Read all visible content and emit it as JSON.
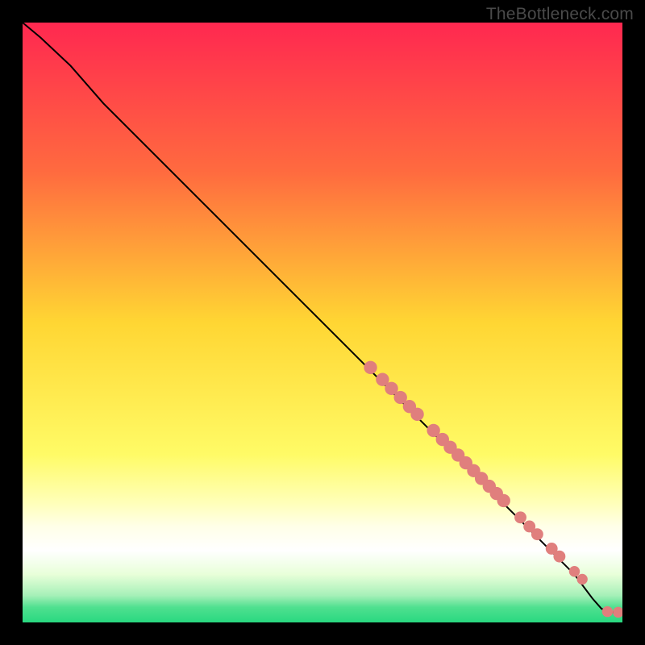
{
  "watermark": "TheBottleneck.com",
  "chart_data": {
    "type": "line",
    "title": "",
    "xlabel": "",
    "ylabel": "",
    "x_range": [
      0,
      100
    ],
    "y_range": [
      0,
      100
    ],
    "background_gradient_stops": [
      {
        "offset": 0.0,
        "color": "#ff2850"
      },
      {
        "offset": 0.25,
        "color": "#ff6b3f"
      },
      {
        "offset": 0.5,
        "color": "#ffd633"
      },
      {
        "offset": 0.72,
        "color": "#fffb66"
      },
      {
        "offset": 0.8,
        "color": "#ffffb8"
      },
      {
        "offset": 0.84,
        "color": "#ffffe8"
      },
      {
        "offset": 0.88,
        "color": "#ffffff"
      },
      {
        "offset": 0.92,
        "color": "#e8ffd9"
      },
      {
        "offset": 0.955,
        "color": "#a6f0b8"
      },
      {
        "offset": 0.975,
        "color": "#4fe08f"
      },
      {
        "offset": 1.0,
        "color": "#29d880"
      }
    ],
    "curve_points": [
      {
        "x": 0.0,
        "y": 100.0
      },
      {
        "x": 3.0,
        "y": 97.5
      },
      {
        "x": 8.0,
        "y": 92.8
      },
      {
        "x": 13.5,
        "y": 86.5
      },
      {
        "x": 55.0,
        "y": 45.0
      },
      {
        "x": 92.0,
        "y": 8.0
      },
      {
        "x": 95.0,
        "y": 4.0
      },
      {
        "x": 96.5,
        "y": 2.3
      },
      {
        "x": 97.8,
        "y": 1.7
      },
      {
        "x": 100.0,
        "y": 1.7
      }
    ],
    "markers": [
      {
        "x": 58.0,
        "y": 42.5,
        "r": 1.1
      },
      {
        "x": 60.0,
        "y": 40.5,
        "r": 1.1
      },
      {
        "x": 61.5,
        "y": 39.0,
        "r": 1.1
      },
      {
        "x": 63.0,
        "y": 37.5,
        "r": 1.1
      },
      {
        "x": 64.5,
        "y": 36.0,
        "r": 1.1
      },
      {
        "x": 65.8,
        "y": 34.7,
        "r": 1.1
      },
      {
        "x": 68.5,
        "y": 32.0,
        "r": 1.1
      },
      {
        "x": 70.0,
        "y": 30.5,
        "r": 1.1
      },
      {
        "x": 71.3,
        "y": 29.2,
        "r": 1.1
      },
      {
        "x": 72.6,
        "y": 27.9,
        "r": 1.1
      },
      {
        "x": 73.9,
        "y": 26.6,
        "r": 1.1
      },
      {
        "x": 75.2,
        "y": 25.3,
        "r": 1.1
      },
      {
        "x": 76.5,
        "y": 24.0,
        "r": 1.1
      },
      {
        "x": 77.8,
        "y": 22.7,
        "r": 1.1
      },
      {
        "x": 79.0,
        "y": 21.5,
        "r": 1.1
      },
      {
        "x": 80.2,
        "y": 20.3,
        "r": 1.1
      },
      {
        "x": 83.0,
        "y": 17.5,
        "r": 1.0
      },
      {
        "x": 84.5,
        "y": 16.0,
        "r": 1.0
      },
      {
        "x": 85.8,
        "y": 14.7,
        "r": 1.0
      },
      {
        "x": 88.2,
        "y": 12.3,
        "r": 1.0
      },
      {
        "x": 89.5,
        "y": 11.0,
        "r": 1.0
      },
      {
        "x": 92.0,
        "y": 8.5,
        "r": 0.9
      },
      {
        "x": 93.3,
        "y": 7.2,
        "r": 0.9
      },
      {
        "x": 97.5,
        "y": 1.8,
        "r": 0.9
      },
      {
        "x": 99.3,
        "y": 1.7,
        "r": 0.9
      }
    ],
    "curve_color": "#000000",
    "marker_color": "#e07f7d"
  }
}
